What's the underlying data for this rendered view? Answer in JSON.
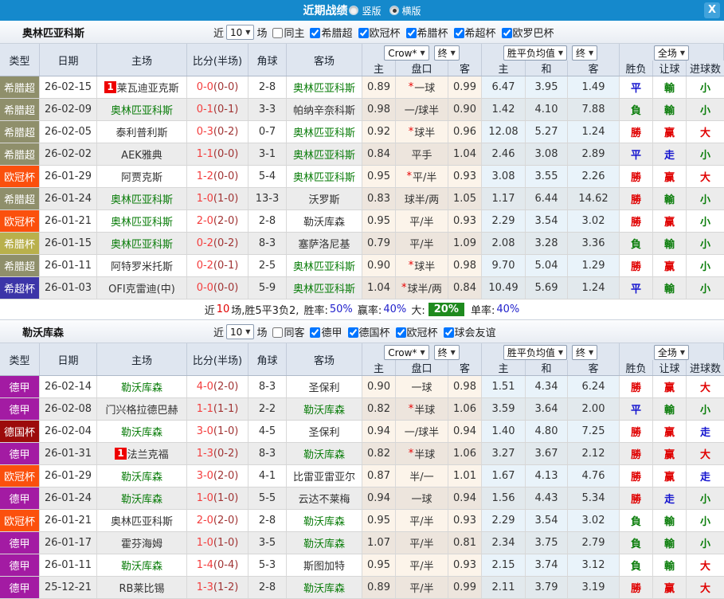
{
  "titlebar": {
    "title": "近期战绩",
    "radios": [
      {
        "label": "竖版",
        "selected": false
      },
      {
        "label": "横版",
        "selected": true
      }
    ],
    "close_glyph": "X"
  },
  "colors": {
    "topbar": "#1589cc",
    "team_green": "#0a7d0a",
    "score_red": "#f43d3d",
    "half_red": "#a03434",
    "win_red": "#e00000",
    "draw_blue": "#1414cf",
    "lose_green": "#0a7d0a",
    "rank_badge_red": "#ee0000",
    "summary_badge_green": "#1e8a1e",
    "type_colors": {
      "希腊超": "#8f8f6b",
      "欧冠杯": "#fb500d",
      "希腊杯": "#b9b04c",
      "希超杯": "#3c35a8",
      "德甲": "#a31ba3",
      "德国杯": "#9c0b0b"
    }
  },
  "table_header": {
    "left_cols": [
      "类型",
      "日期",
      "主场",
      "比分(半场)",
      "角球",
      "客场"
    ],
    "dropdowns": [
      "Crow*",
      "终",
      "胜平负均值",
      "终",
      "全场"
    ],
    "dropdown_arrow": "▼",
    "sub_cols": [
      "主",
      "盘口",
      "客",
      "主",
      "和",
      "客",
      "胜负",
      "让球",
      "进球数"
    ]
  },
  "sections": [
    {
      "team": "奥林匹亚科斯",
      "filter": {
        "near_label": "近",
        "count": "10",
        "games_label": "场",
        "same": {
          "label": "同主",
          "checked": false
        },
        "leagues": [
          {
            "label": "希腊超",
            "checked": true
          },
          {
            "label": "欧冠杯",
            "checked": true
          },
          {
            "label": "希腊杯",
            "checked": true
          },
          {
            "label": "希超杯",
            "checked": true
          },
          {
            "label": "欧罗巴杯",
            "checked": true
          }
        ]
      },
      "rows": [
        {
          "type": "希腊超",
          "date": "26-02-15",
          "rank": "1",
          "home": "莱瓦迪亚克斯",
          "home_self": false,
          "ft": "0-0",
          "ht": "(0-0)",
          "corner": "2-8",
          "away": "奥林匹亚科斯",
          "away_self": true,
          "oh": "0.89",
          "star": true,
          "hcap": "一球",
          "oa": "0.99",
          "eh": "6.47",
          "ed": "3.95",
          "ea": "1.49",
          "res": [
            [
              "平",
              "d"
            ],
            [
              "輸",
              "l"
            ],
            [
              "小",
              "l"
            ]
          ]
        },
        {
          "type": "希腊超",
          "date": "26-02-09",
          "rank": "",
          "home": "奥林匹亚科斯",
          "home_self": true,
          "ft": "0-1",
          "ht": "(0-1)",
          "corner": "3-3",
          "away": "帕纳辛奈科斯",
          "away_self": false,
          "oh": "0.98",
          "star": false,
          "hcap": "一/球半",
          "oa": "0.90",
          "eh": "1.42",
          "ed": "4.10",
          "ea": "7.88",
          "res": [
            [
              "負",
              "l"
            ],
            [
              "輸",
              "l"
            ],
            [
              "小",
              "l"
            ]
          ]
        },
        {
          "type": "希腊超",
          "date": "26-02-05",
          "rank": "",
          "home": "泰利普利斯",
          "home_self": false,
          "ft": "0-3",
          "ht": "(0-2)",
          "corner": "0-7",
          "away": "奥林匹亚科斯",
          "away_self": true,
          "oh": "0.92",
          "star": true,
          "hcap": "球半",
          "oa": "0.96",
          "eh": "12.08",
          "ed": "5.27",
          "ea": "1.24",
          "res": [
            [
              "勝",
              "w"
            ],
            [
              "赢",
              "w"
            ],
            [
              "大",
              "w"
            ]
          ]
        },
        {
          "type": "希腊超",
          "date": "26-02-02",
          "rank": "",
          "home": "AEK雅典",
          "home_self": false,
          "ft": "1-1",
          "ht": "(0-0)",
          "corner": "3-1",
          "away": "奥林匹亚科斯",
          "away_self": true,
          "oh": "0.84",
          "star": false,
          "hcap": "平手",
          "oa": "1.04",
          "eh": "2.46",
          "ed": "3.08",
          "ea": "2.89",
          "res": [
            [
              "平",
              "d"
            ],
            [
              "走",
              "d"
            ],
            [
              "小",
              "l"
            ]
          ]
        },
        {
          "type": "欧冠杯",
          "date": "26-01-29",
          "rank": "",
          "home": "阿贾克斯",
          "home_self": false,
          "ft": "1-2",
          "ht": "(0-0)",
          "corner": "5-4",
          "away": "奥林匹亚科斯",
          "away_self": true,
          "oh": "0.95",
          "star": true,
          "hcap": "平/半",
          "oa": "0.93",
          "eh": "3.08",
          "ed": "3.55",
          "ea": "2.26",
          "res": [
            [
              "勝",
              "w"
            ],
            [
              "赢",
              "w"
            ],
            [
              "大",
              "w"
            ]
          ]
        },
        {
          "type": "希腊超",
          "date": "26-01-24",
          "rank": "",
          "home": "奥林匹亚科斯",
          "home_self": true,
          "ft": "1-0",
          "ht": "(1-0)",
          "corner": "13-3",
          "away": "沃罗斯",
          "away_self": false,
          "oh": "0.83",
          "star": false,
          "hcap": "球半/两",
          "oa": "1.05",
          "eh": "1.17",
          "ed": "6.44",
          "ea": "14.62",
          "res": [
            [
              "勝",
              "w"
            ],
            [
              "輸",
              "l"
            ],
            [
              "小",
              "l"
            ]
          ]
        },
        {
          "type": "欧冠杯",
          "date": "26-01-21",
          "rank": "",
          "home": "奥林匹亚科斯",
          "home_self": true,
          "ft": "2-0",
          "ht": "(2-0)",
          "corner": "2-8",
          "away": "勒沃库森",
          "away_self": false,
          "oh": "0.95",
          "star": false,
          "hcap": "平/半",
          "oa": "0.93",
          "eh": "2.29",
          "ed": "3.54",
          "ea": "3.02",
          "res": [
            [
              "勝",
              "w"
            ],
            [
              "赢",
              "w"
            ],
            [
              "小",
              "l"
            ]
          ]
        },
        {
          "type": "希腊杯",
          "date": "26-01-15",
          "rank": "",
          "home": "奥林匹亚科斯",
          "home_self": true,
          "ft": "0-2",
          "ht": "(0-2)",
          "corner": "8-3",
          "away": "塞萨洛尼基",
          "away_self": false,
          "oh": "0.79",
          "star": false,
          "hcap": "平/半",
          "oa": "1.09",
          "eh": "2.08",
          "ed": "3.28",
          "ea": "3.36",
          "res": [
            [
              "負",
              "l"
            ],
            [
              "輸",
              "l"
            ],
            [
              "小",
              "l"
            ]
          ]
        },
        {
          "type": "希腊超",
          "date": "26-01-11",
          "rank": "",
          "home": "阿特罗米托斯",
          "home_self": false,
          "ft": "0-2",
          "ht": "(0-1)",
          "corner": "2-5",
          "away": "奥林匹亚科斯",
          "away_self": true,
          "oh": "0.90",
          "star": true,
          "hcap": "球半",
          "oa": "0.98",
          "eh": "9.70",
          "ed": "5.04",
          "ea": "1.29",
          "res": [
            [
              "勝",
              "w"
            ],
            [
              "赢",
              "w"
            ],
            [
              "小",
              "l"
            ]
          ]
        },
        {
          "type": "希超杯",
          "date": "26-01-03",
          "rank": "",
          "home": "OFI克雷迪(中)",
          "home_self": false,
          "ft": "0-0",
          "ht": "(0-0)",
          "corner": "5-9",
          "away": "奥林匹亚科斯",
          "away_self": true,
          "oh": "1.04",
          "star": true,
          "hcap": "球半/两",
          "oa": "0.84",
          "eh": "10.49",
          "ed": "5.69",
          "ea": "1.24",
          "res": [
            [
              "平",
              "d"
            ],
            [
              "輸",
              "l"
            ],
            [
              "小",
              "l"
            ]
          ]
        }
      ],
      "summary": {
        "near": "近",
        "count": "10",
        "record": "场,胜5平3负2,",
        "win_rate_label": "胜率:",
        "win_rate": "50%",
        "cover_rate_label": "赢率:",
        "cover_rate": "40%",
        "big_label": "大:",
        "big_rate": "20%",
        "single_label": "单率:",
        "single_rate": "40%"
      }
    },
    {
      "team": "勒沃库森",
      "filter": {
        "near_label": "近",
        "count": "10",
        "games_label": "场",
        "same": {
          "label": "同客",
          "checked": false
        },
        "leagues": [
          {
            "label": "德甲",
            "checked": true
          },
          {
            "label": "德国杯",
            "checked": true
          },
          {
            "label": "欧冠杯",
            "checked": true
          },
          {
            "label": "球会友谊",
            "checked": true
          }
        ]
      },
      "rows": [
        {
          "type": "德甲",
          "date": "26-02-14",
          "rank": "",
          "home": "勒沃库森",
          "home_self": true,
          "ft": "4-0",
          "ht": "(2-0)",
          "corner": "8-3",
          "away": "圣保利",
          "away_self": false,
          "oh": "0.90",
          "star": false,
          "hcap": "一球",
          "oa": "0.98",
          "eh": "1.51",
          "ed": "4.34",
          "ea": "6.24",
          "res": [
            [
              "勝",
              "w"
            ],
            [
              "赢",
              "w"
            ],
            [
              "大",
              "w"
            ]
          ]
        },
        {
          "type": "德甲",
          "date": "26-02-08",
          "rank": "",
          "home": "门兴格拉德巴赫",
          "home_self": false,
          "ft": "1-1",
          "ht": "(1-1)",
          "corner": "2-2",
          "away": "勒沃库森",
          "away_self": true,
          "oh": "0.82",
          "star": true,
          "hcap": "半球",
          "oa": "1.06",
          "eh": "3.59",
          "ed": "3.64",
          "ea": "2.00",
          "res": [
            [
              "平",
              "d"
            ],
            [
              "輸",
              "l"
            ],
            [
              "小",
              "l"
            ]
          ]
        },
        {
          "type": "德国杯",
          "date": "26-02-04",
          "rank": "",
          "home": "勒沃库森",
          "home_self": true,
          "ft": "3-0",
          "ht": "(1-0)",
          "corner": "4-5",
          "away": "圣保利",
          "away_self": false,
          "oh": "0.94",
          "star": false,
          "hcap": "一/球半",
          "oa": "0.94",
          "eh": "1.40",
          "ed": "4.80",
          "ea": "7.25",
          "res": [
            [
              "勝",
              "w"
            ],
            [
              "赢",
              "w"
            ],
            [
              "走",
              "d"
            ]
          ]
        },
        {
          "type": "德甲",
          "date": "26-01-31",
          "rank": "1",
          "home": "法兰克福",
          "home_self": false,
          "ft": "1-3",
          "ht": "(0-2)",
          "corner": "8-3",
          "away": "勒沃库森",
          "away_self": true,
          "oh": "0.82",
          "star": true,
          "hcap": "半球",
          "oa": "1.06",
          "eh": "3.27",
          "ed": "3.67",
          "ea": "2.12",
          "res": [
            [
              "勝",
              "w"
            ],
            [
              "赢",
              "w"
            ],
            [
              "大",
              "w"
            ]
          ]
        },
        {
          "type": "欧冠杯",
          "date": "26-01-29",
          "rank": "",
          "home": "勒沃库森",
          "home_self": true,
          "ft": "3-0",
          "ht": "(2-0)",
          "corner": "4-1",
          "away": "比雷亚雷亚尔",
          "away_self": false,
          "oh": "0.87",
          "star": false,
          "hcap": "半/一",
          "oa": "1.01",
          "eh": "1.67",
          "ed": "4.13",
          "ea": "4.76",
          "res": [
            [
              "勝",
              "w"
            ],
            [
              "赢",
              "w"
            ],
            [
              "走",
              "d"
            ]
          ]
        },
        {
          "type": "德甲",
          "date": "26-01-24",
          "rank": "",
          "home": "勒沃库森",
          "home_self": true,
          "ft": "1-0",
          "ht": "(1-0)",
          "corner": "5-5",
          "away": "云达不莱梅",
          "away_self": false,
          "oh": "0.94",
          "star": false,
          "hcap": "一球",
          "oa": "0.94",
          "eh": "1.56",
          "ed": "4.43",
          "ea": "5.34",
          "res": [
            [
              "勝",
              "w"
            ],
            [
              "走",
              "d"
            ],
            [
              "小",
              "l"
            ]
          ]
        },
        {
          "type": "欧冠杯",
          "date": "26-01-21",
          "rank": "",
          "home": "奥林匹亚科斯",
          "home_self": false,
          "ft": "2-0",
          "ht": "(2-0)",
          "corner": "2-8",
          "away": "勒沃库森",
          "away_self": true,
          "oh": "0.95",
          "star": false,
          "hcap": "平/半",
          "oa": "0.93",
          "eh": "2.29",
          "ed": "3.54",
          "ea": "3.02",
          "res": [
            [
              "負",
              "l"
            ],
            [
              "輸",
              "l"
            ],
            [
              "小",
              "l"
            ]
          ]
        },
        {
          "type": "德甲",
          "date": "26-01-17",
          "rank": "",
          "home": "霍芬海姆",
          "home_self": false,
          "ft": "1-0",
          "ht": "(1-0)",
          "corner": "3-5",
          "away": "勒沃库森",
          "away_self": true,
          "oh": "1.07",
          "star": false,
          "hcap": "平/半",
          "oa": "0.81",
          "eh": "2.34",
          "ed": "3.75",
          "ea": "2.79",
          "res": [
            [
              "負",
              "l"
            ],
            [
              "輸",
              "l"
            ],
            [
              "小",
              "l"
            ]
          ]
        },
        {
          "type": "德甲",
          "date": "26-01-11",
          "rank": "",
          "home": "勒沃库森",
          "home_self": true,
          "ft": "1-4",
          "ht": "(0-4)",
          "corner": "5-3",
          "away": "斯图加特",
          "away_self": false,
          "oh": "0.95",
          "star": false,
          "hcap": "平/半",
          "oa": "0.93",
          "eh": "2.15",
          "ed": "3.74",
          "ea": "3.12",
          "res": [
            [
              "負",
              "l"
            ],
            [
              "輸",
              "l"
            ],
            [
              "大",
              "w"
            ]
          ]
        },
        {
          "type": "德甲",
          "date": "25-12-21",
          "rank": "",
          "home": "RB莱比锡",
          "home_self": false,
          "ft": "1-3",
          "ht": "(1-2)",
          "corner": "2-8",
          "away": "勒沃库森",
          "away_self": true,
          "oh": "0.89",
          "star": false,
          "hcap": "平/半",
          "oa": "0.99",
          "eh": "2.11",
          "ed": "3.79",
          "ea": "3.19",
          "res": [
            [
              "勝",
              "w"
            ],
            [
              "赢",
              "w"
            ],
            [
              "大",
              "w"
            ]
          ]
        }
      ],
      "summary": null
    }
  ]
}
